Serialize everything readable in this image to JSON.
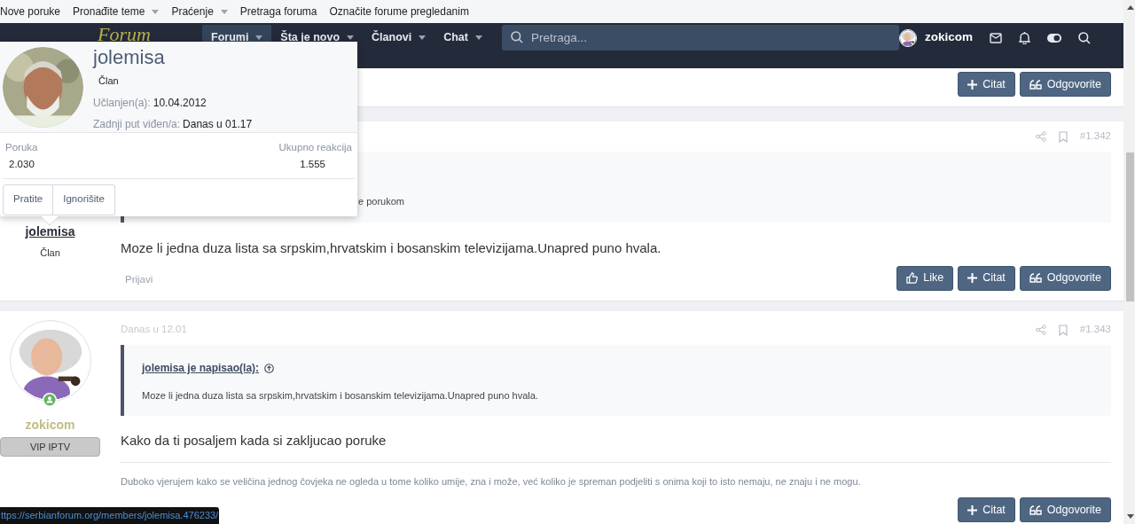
{
  "top_nav": [
    {
      "label": "Nove poruke",
      "dropdown": false
    },
    {
      "label": "Pronađite teme",
      "dropdown": true
    },
    {
      "label": "Praćenje",
      "dropdown": true
    },
    {
      "label": "Pretraga foruma",
      "dropdown": false
    },
    {
      "label": "Označite forume pregledanim",
      "dropdown": false
    }
  ],
  "header": {
    "logo_text": "Forum",
    "tabs": [
      {
        "label": "Forumi",
        "selected": true
      },
      {
        "label": "Šta je novo",
        "selected": false
      },
      {
        "label": "Članovi",
        "selected": false
      },
      {
        "label": "Chat",
        "selected": false
      }
    ],
    "search": {
      "placeholder": "Pretraga..."
    },
    "user": "zokicom"
  },
  "posts": [
    {
      "kind": "tail",
      "actions": [
        "Citat",
        "Odgovorite"
      ]
    },
    {
      "kind": "post",
      "author": "jolemisa",
      "role": "Član",
      "number": "#1.342",
      "quote_visible": "e porukom",
      "message": "Moze li jedna duza lista sa srpskim,hrvatskim i bosanskim televizijama.Unapred puno hvala.",
      "report": "Prijavi",
      "actions": [
        "Like",
        "Citat",
        "Odgovorite"
      ]
    },
    {
      "kind": "post_full",
      "author": "zokicom",
      "online": true,
      "badge": "VIP IPTV",
      "time": "Danas u 12.01",
      "number": "#1.343",
      "quote_author": "jolemisa je napisao(la):",
      "quote_text": "Moze li jedna duza lista sa srpskim,hrvatskim i bosanskim televizijama.Unapred puno hvala.",
      "message": "Kako da ti posaljem kada si zakljucao poruke",
      "signature": "Duboko vjerujem kako se veličina jednog čovjeka ne ogleda u tome koliko umije, zna i može, već koliko je spreman podjeliti s onima koji to isto nemaju, ne znaju i ne mogu.",
      "actions": [
        "Citat",
        "Odgovorite"
      ]
    }
  ],
  "profile_popup": {
    "name": "jolemisa",
    "role": "Član",
    "joined_label": "Učlanjen(a):",
    "joined": "10.04.2012",
    "last_seen_label": "Zadnji put viđen/a:",
    "last_seen": "Danas u 01.17",
    "stats": [
      {
        "label": "Poruka",
        "value": "2.030"
      },
      {
        "label": "Ukupno reakcija",
        "value": "1.555"
      }
    ],
    "buttons": [
      "Pratite",
      "Ignorišite"
    ]
  },
  "status_url": "ttps://serbianforum.org/members/jolemisa.476233/"
}
